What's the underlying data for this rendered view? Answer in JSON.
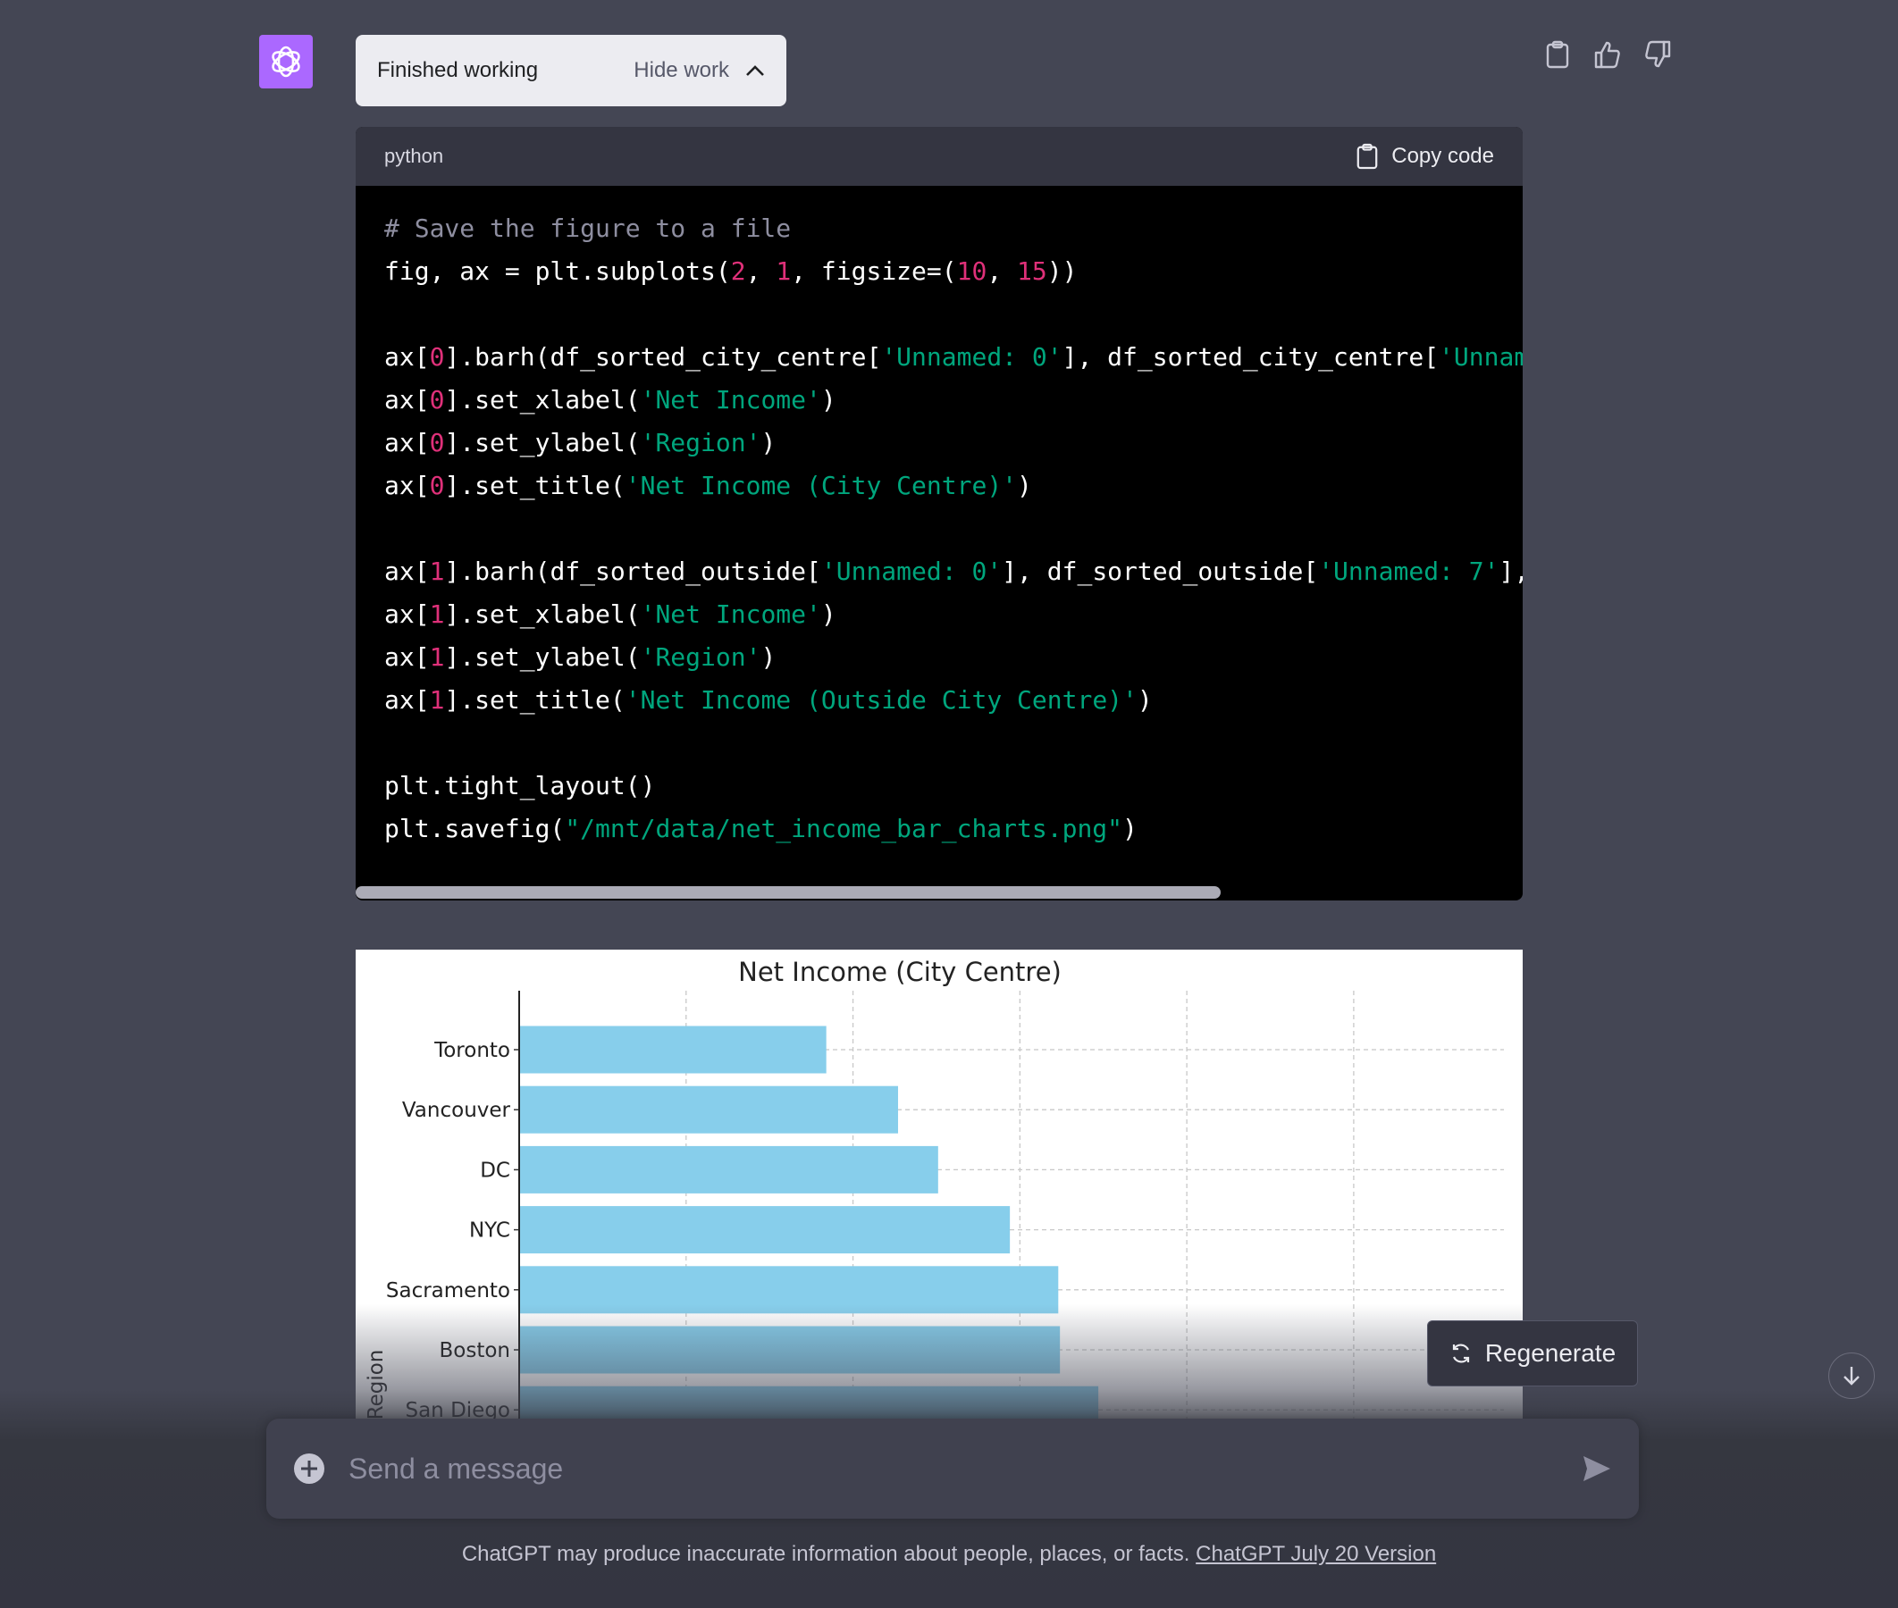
{
  "work": {
    "status": "Finished working",
    "toggle": "Hide work"
  },
  "message_actions": [
    "clipboard-icon",
    "thumbs-up-icon",
    "thumbs-down-icon"
  ],
  "code_block": {
    "language": "python",
    "copy_label": "Copy code",
    "lines": [
      [
        {
          "t": "c",
          "v": "# Save the figure to a file"
        }
      ],
      [
        {
          "t": "p",
          "v": "fig, ax = plt.subplots("
        },
        {
          "t": "n",
          "v": "2"
        },
        {
          "t": "p",
          "v": ", "
        },
        {
          "t": "n",
          "v": "1"
        },
        {
          "t": "p",
          "v": ", figsize=("
        },
        {
          "t": "n",
          "v": "10"
        },
        {
          "t": "p",
          "v": ", "
        },
        {
          "t": "n",
          "v": "15"
        },
        {
          "t": "p",
          "v": "))"
        }
      ],
      [],
      [
        {
          "t": "p",
          "v": "ax["
        },
        {
          "t": "n",
          "v": "0"
        },
        {
          "t": "p",
          "v": "].barh(df_sorted_city_centre["
        },
        {
          "t": "s",
          "v": "'Unnamed: 0'"
        },
        {
          "t": "p",
          "v": "], df_sorted_city_centre["
        },
        {
          "t": "s",
          "v": "'Unnam"
        }
      ],
      [
        {
          "t": "p",
          "v": "ax["
        },
        {
          "t": "n",
          "v": "0"
        },
        {
          "t": "p",
          "v": "].set_xlabel("
        },
        {
          "t": "s",
          "v": "'Net Income'"
        },
        {
          "t": "p",
          "v": ")"
        }
      ],
      [
        {
          "t": "p",
          "v": "ax["
        },
        {
          "t": "n",
          "v": "0"
        },
        {
          "t": "p",
          "v": "].set_ylabel("
        },
        {
          "t": "s",
          "v": "'Region'"
        },
        {
          "t": "p",
          "v": ")"
        }
      ],
      [
        {
          "t": "p",
          "v": "ax["
        },
        {
          "t": "n",
          "v": "0"
        },
        {
          "t": "p",
          "v": "].set_title("
        },
        {
          "t": "s",
          "v": "'Net Income (City Centre)'"
        },
        {
          "t": "p",
          "v": ")"
        }
      ],
      [],
      [
        {
          "t": "p",
          "v": "ax["
        },
        {
          "t": "n",
          "v": "1"
        },
        {
          "t": "p",
          "v": "].barh(df_sorted_outside["
        },
        {
          "t": "s",
          "v": "'Unnamed: 0'"
        },
        {
          "t": "p",
          "v": "], df_sorted_outside["
        },
        {
          "t": "s",
          "v": "'Unnamed: 7'"
        },
        {
          "t": "p",
          "v": "],"
        }
      ],
      [
        {
          "t": "p",
          "v": "ax["
        },
        {
          "t": "n",
          "v": "1"
        },
        {
          "t": "p",
          "v": "].set_xlabel("
        },
        {
          "t": "s",
          "v": "'Net Income'"
        },
        {
          "t": "p",
          "v": ")"
        }
      ],
      [
        {
          "t": "p",
          "v": "ax["
        },
        {
          "t": "n",
          "v": "1"
        },
        {
          "t": "p",
          "v": "].set_ylabel("
        },
        {
          "t": "s",
          "v": "'Region'"
        },
        {
          "t": "p",
          "v": ")"
        }
      ],
      [
        {
          "t": "p",
          "v": "ax["
        },
        {
          "t": "n",
          "v": "1"
        },
        {
          "t": "p",
          "v": "].set_title("
        },
        {
          "t": "s",
          "v": "'Net Income (Outside City Centre)'"
        },
        {
          "t": "p",
          "v": ")"
        }
      ],
      [],
      [
        {
          "t": "p",
          "v": "plt.tight_layout()"
        }
      ],
      [
        {
          "t": "p",
          "v": "plt.savefig("
        },
        {
          "t": "s",
          "v": "\"/mnt/data/net_income_bar_charts.png\""
        },
        {
          "t": "p",
          "v": ")"
        }
      ]
    ]
  },
  "chart_data": {
    "type": "bar",
    "orientation": "horizontal",
    "title": "Net Income (City Centre)",
    "ylabel": "Region",
    "xlabel": "",
    "categories": [
      "Toronto",
      "Vancouver",
      "DC",
      "NYC",
      "Sacramento",
      "Boston",
      "San Diego"
    ],
    "values": [
      1.84,
      2.27,
      2.51,
      2.94,
      3.23,
      3.24,
      3.47
    ],
    "xlim": [
      0,
      5.9
    ],
    "grid": true,
    "bar_color": "#87ceeb",
    "partially_visible": true
  },
  "regenerate_label": "Regenerate",
  "composer": {
    "placeholder": "Send a message"
  },
  "footer": {
    "text": "ChatGPT may produce inaccurate information about people, places, or facts.",
    "link": "ChatGPT July 20 Version"
  },
  "colors": {
    "background": "#444654",
    "avatar": "#ab68ff",
    "code_bg": "#000000",
    "string": "#00a67d",
    "number": "#df3079",
    "comment": "#8e8ea0"
  }
}
